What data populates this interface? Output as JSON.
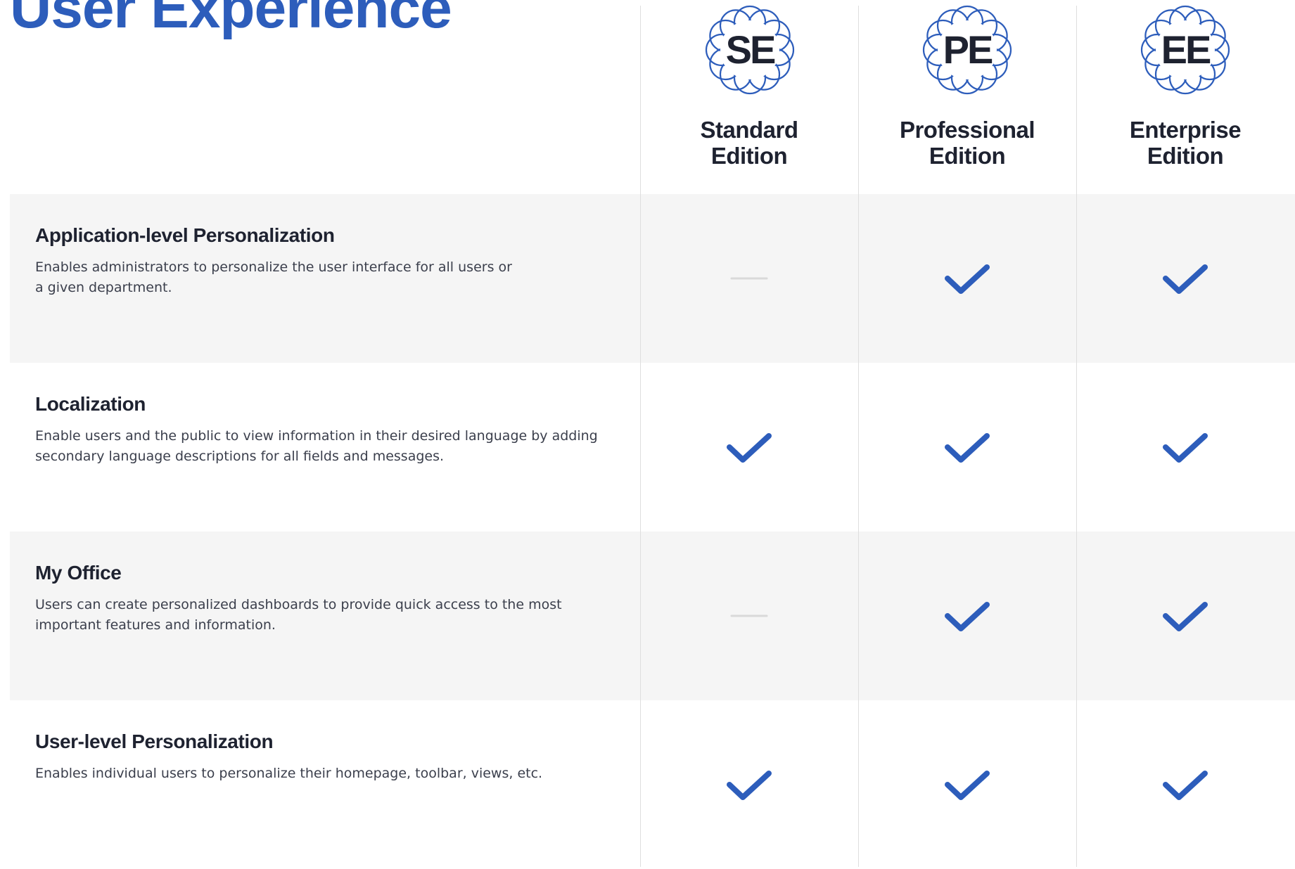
{
  "page": {
    "title": "User Experience"
  },
  "editions": [
    {
      "abbr": "SE",
      "name_line1": "Standard",
      "name_line2": "Edition"
    },
    {
      "abbr": "PE",
      "name_line1": "Professional",
      "name_line2": "Edition"
    },
    {
      "abbr": "EE",
      "name_line1": "Enterprise",
      "name_line2": "Edition"
    }
  ],
  "features": [
    {
      "title": "Application-level Personalization",
      "description_line1": "Enables administrators to personalize the user interface for all users or",
      "description_line2": "a given department.",
      "availability": [
        "not-included",
        "included",
        "included"
      ]
    },
    {
      "title": "Localization",
      "description_line1": "Enable users and the public to view information in their desired language by adding",
      "description_line2": "secondary language descriptions for all fields and messages.",
      "availability": [
        "included",
        "included",
        "included"
      ]
    },
    {
      "title": "My Office",
      "description_line1": "Users can create personalized dashboards to provide quick access to the most",
      "description_line2": "important features and information.",
      "availability": [
        "not-included",
        "included",
        "included"
      ]
    },
    {
      "title": "User-level Personalization",
      "description_line1": "Enables individual users to personalize their homepage, toolbar, views, etc.",
      "description_line2": "",
      "availability": [
        "included",
        "included",
        "included"
      ]
    }
  ],
  "icons": {
    "included": "checkmark-icon",
    "not-included": "dash-icon",
    "badge": "scalloped-badge-icon"
  },
  "colors": {
    "accent": "#2d5dbb",
    "heading": "#1e2230",
    "body_text": "#3b3f4c",
    "row_shade": "#f5f5f5",
    "divider": "#dedede",
    "dash": "#d9d9d9"
  }
}
